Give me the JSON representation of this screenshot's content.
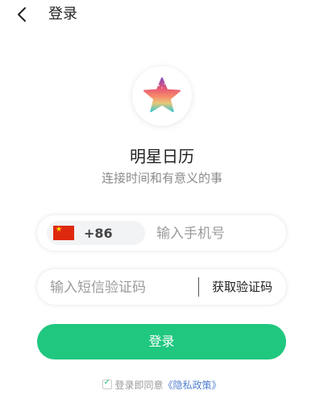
{
  "header": {
    "title": "登录",
    "back_icon": "chevron-left-icon"
  },
  "app": {
    "name": "明星日历",
    "slogan": "连接时间和有意义的事",
    "logo_icon": "star-logo-icon"
  },
  "phone": {
    "country_code": "+86",
    "flag_icon": "china-flag-icon",
    "placeholder": "输入手机号",
    "value": ""
  },
  "sms": {
    "placeholder": "输入短信验证码",
    "value": "",
    "get_code_label": "获取验证码"
  },
  "login_button": {
    "label": "登录"
  },
  "agreement": {
    "checked": true,
    "text": "登录即同意",
    "policy_link": "《隐私政策》"
  },
  "colors": {
    "accent": "#20c77f",
    "link": "#4f7fcf",
    "placeholder": "#9b9b9b"
  }
}
